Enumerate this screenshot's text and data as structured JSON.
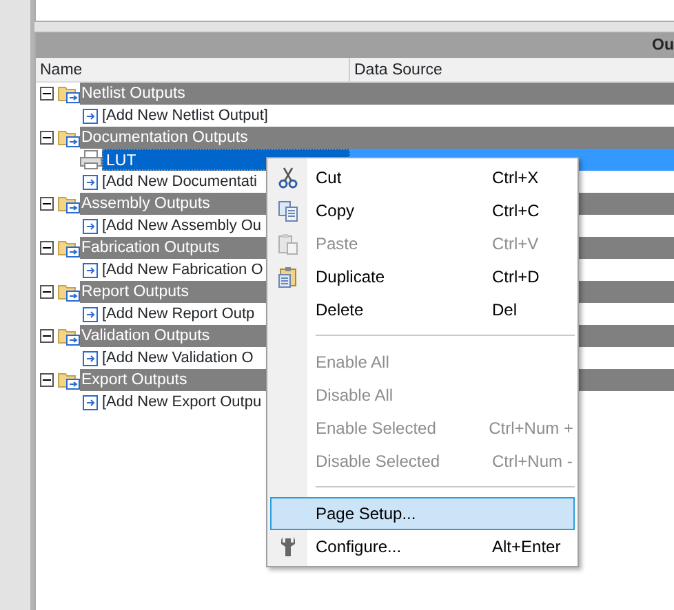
{
  "panel_header": {
    "title": "Ou"
  },
  "columns": [
    "Name",
    "Data Source"
  ],
  "tree": [
    {
      "kind": "group",
      "label": "Netlist Outputs",
      "expanded": true,
      "children": [
        {
          "kind": "add",
          "label": "[Add New Netlist Output]"
        }
      ]
    },
    {
      "kind": "group",
      "label": "Documentation Outputs",
      "expanded": true,
      "children": [
        {
          "kind": "item",
          "label": "LUT",
          "selected": true
        },
        {
          "kind": "add",
          "label": "[Add New Documentati"
        }
      ]
    },
    {
      "kind": "group",
      "label": "Assembly Outputs",
      "expanded": true,
      "children": [
        {
          "kind": "add",
          "label": "[Add New Assembly Ou"
        }
      ]
    },
    {
      "kind": "group",
      "label": "Fabrication Outputs",
      "expanded": true,
      "children": [
        {
          "kind": "add",
          "label": "[Add New Fabrication O"
        }
      ]
    },
    {
      "kind": "group",
      "label": "Report Outputs",
      "expanded": true,
      "children": [
        {
          "kind": "add",
          "label": "[Add New Report Outp"
        }
      ]
    },
    {
      "kind": "group",
      "label": "Validation Outputs",
      "expanded": true,
      "children": [
        {
          "kind": "add",
          "label": "[Add New Validation O"
        }
      ]
    },
    {
      "kind": "group",
      "label": "Export Outputs",
      "expanded": true,
      "children": [
        {
          "kind": "add",
          "label": "[Add New Export Outpu"
        }
      ]
    }
  ],
  "context_menu": [
    {
      "kind": "item",
      "label": "Cut",
      "shortcut": "Ctrl+X",
      "disabled": false,
      "selected": false
    },
    {
      "kind": "item",
      "label": "Copy",
      "shortcut": "Ctrl+C",
      "disabled": false,
      "selected": false
    },
    {
      "kind": "item",
      "label": "Paste",
      "shortcut": "Ctrl+V",
      "disabled": true,
      "selected": false
    },
    {
      "kind": "item",
      "label": "Duplicate",
      "shortcut": "Ctrl+D",
      "disabled": false,
      "selected": false
    },
    {
      "kind": "item",
      "label": "Delete",
      "shortcut": "Del",
      "disabled": false,
      "selected": false
    },
    {
      "kind": "separator"
    },
    {
      "kind": "item",
      "label": "Enable All",
      "disabled": true,
      "selected": false
    },
    {
      "kind": "item",
      "label": "Disable All",
      "disabled": true,
      "selected": false
    },
    {
      "kind": "item",
      "label": "Enable Selected",
      "shortcut": "Ctrl+Num +",
      "disabled": true,
      "selected": false
    },
    {
      "kind": "item",
      "label": "Disable Selected",
      "shortcut": "Ctrl+Num -",
      "disabled": true,
      "selected": false
    },
    {
      "kind": "separator"
    },
    {
      "kind": "item",
      "label": "Page Setup...",
      "disabled": false,
      "selected": true
    },
    {
      "kind": "item",
      "label": "Configure...",
      "shortcut": "Alt+Enter",
      "disabled": false,
      "selected": false
    }
  ]
}
